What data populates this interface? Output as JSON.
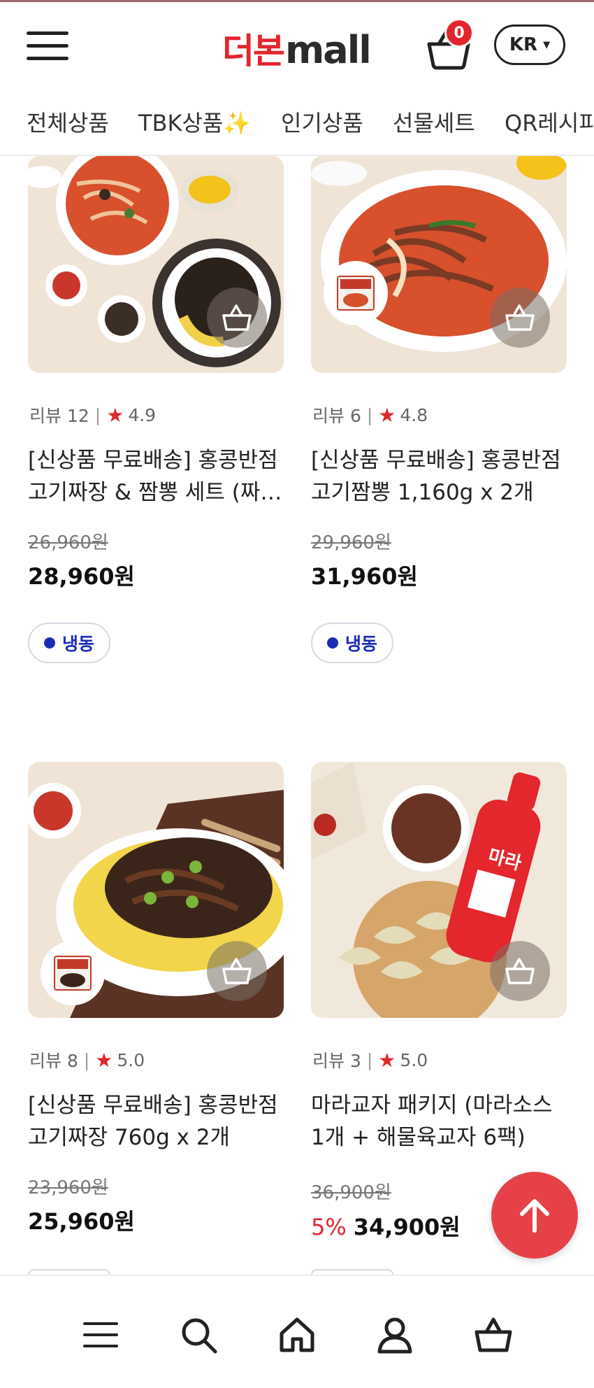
{
  "header": {
    "logo_kr": "더본",
    "logo_en": "mall",
    "cart_count": "0",
    "language": "KR",
    "brand_color": "#e3262d"
  },
  "tabs": [
    {
      "label": "전체상품"
    },
    {
      "label": "TBK상품✨"
    },
    {
      "label": "인기상품"
    },
    {
      "label": "선물세트"
    },
    {
      "label": "QR레시피"
    }
  ],
  "products": [
    {
      "review_label": "리뷰 12",
      "rating": "4.9",
      "title_line1": "[신상품 무료배송] 홍콩반점",
      "title_line2": "고기짜장 & 짬뽕 세트 (짜…",
      "original_price": "26,960원",
      "discount": "",
      "price": "28,960원",
      "tag": "냉동"
    },
    {
      "review_label": "리뷰 6",
      "rating": "4.8",
      "title_line1": "[신상품 무료배송] 홍콩반점",
      "title_line2": "고기짬뽕 1,160g x 2개",
      "original_price": "29,960원",
      "discount": "",
      "price": "31,960원",
      "tag": "냉동"
    },
    {
      "review_label": "리뷰 8",
      "rating": "5.0",
      "title_line1": "[신상품 무료배송] 홍콩반점",
      "title_line2": "고기짜장 760g x 2개",
      "original_price": "23,960원",
      "discount": "",
      "price": "25,960원",
      "tag": ""
    },
    {
      "review_label": "리뷰 3",
      "rating": "5.0",
      "title_line1": "마라교자 패키지 (마라소스",
      "title_line2": "1개 + 해물육교자 6팩)",
      "original_price": "36,900원",
      "discount": "5%",
      "price": "34,900원",
      "tag": ""
    }
  ],
  "icons": {
    "menu": "hamburger-icon",
    "cart": "basket-icon",
    "search": "search-icon",
    "home": "home-icon",
    "user": "user-icon",
    "scroll_top": "arrow-up-icon",
    "star": "star-icon"
  }
}
